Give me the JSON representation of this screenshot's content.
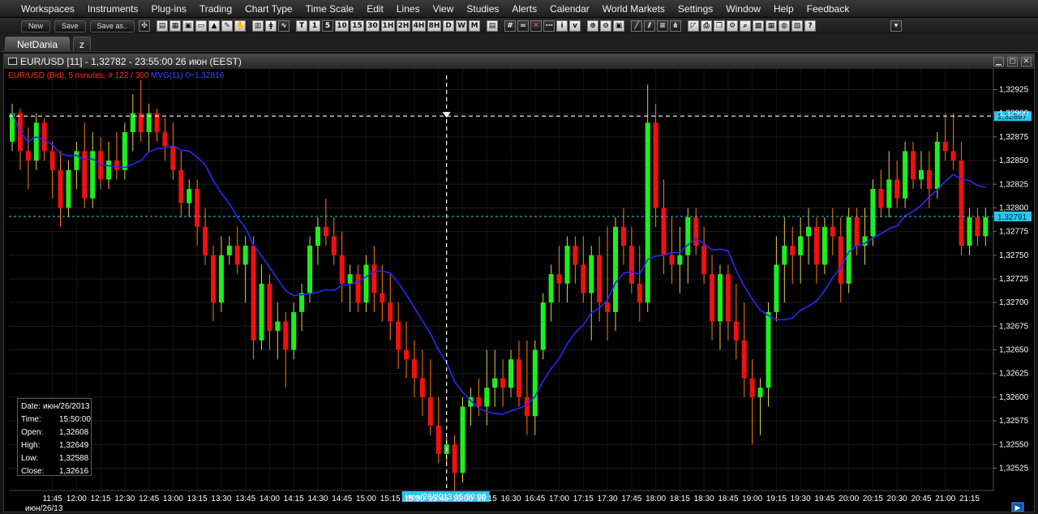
{
  "menu": [
    "Workspaces",
    "Instruments",
    "Plug-ins",
    "Trading",
    "Chart Type",
    "Time Scale",
    "Edit",
    "Lines",
    "View",
    "Studies",
    "Alerts",
    "Calendar",
    "World Markets",
    "Settings",
    "Window",
    "Help",
    "Feedback"
  ],
  "toolbar": {
    "new_label": "New",
    "save_label": "Save",
    "save_as_label": "Save as..",
    "timeframes": [
      "T",
      "1",
      "5",
      "10",
      "15",
      "30",
      "1H",
      "2H",
      "4H",
      "8H",
      "D",
      "W",
      "M"
    ]
  },
  "tabs": [
    "NetDania",
    "z"
  ],
  "window": {
    "title": "EUR/USD [11] - 1,32782 - 23:55:00  26 июн (EEST)"
  },
  "legend": {
    "instrument": "EUR/USD (Bid), 5 minutes, # 122 / 300",
    "indicator": "MVG(11) 0=1,32816"
  },
  "info_box": {
    "rows": [
      {
        "label": "Date:",
        "value": "июн/26/2013"
      },
      {
        "label": "Time:",
        "value": "15:50:00"
      },
      {
        "label": "Open:",
        "value": "1,32608"
      },
      {
        "label": "High:",
        "value": "1,32649"
      },
      {
        "label": "Low:",
        "value": "1,32588"
      },
      {
        "label": "Close:",
        "value": "1,32616"
      }
    ]
  },
  "colors": {
    "up": "#1cf01c",
    "down": "#f01010",
    "wick_up": "#e8d040",
    "wick_down": "#ff7a10",
    "ma": "#2828ff",
    "crosshair": "#ffffff",
    "last_line": "#3ac8d8",
    "price_label_bg": "#28c8f0"
  },
  "chart_data": {
    "type": "candlestick",
    "instrument": "EUR/USD (Bid)",
    "timeframe": "5 minutes",
    "y_ticks": [
      "1,32925",
      "1,32900",
      "1,32875",
      "1,32850",
      "1,32825",
      "1,32800",
      "1,32775",
      "1,32750",
      "1,32725",
      "1,32700",
      "1,32675",
      "1,32650",
      "1,32625",
      "1,32600",
      "1,32575",
      "1,32550",
      "1,32525"
    ],
    "ylim": [
      1.3251,
      1.3294
    ],
    "x_ticks": [
      "11:45",
      "12:00",
      "12:15",
      "12:30",
      "12:45",
      "13:00",
      "13:15",
      "13:30",
      "13:45",
      "14:00",
      "14:15",
      "14:30",
      "14:45",
      "15:00",
      "15:15",
      "15:30",
      "15:45",
      "16:00",
      "16:15",
      "16:30",
      "16:45",
      "17:00",
      "17:15",
      "17:30",
      "17:45",
      "18:00",
      "18:15",
      "18:30",
      "18:45",
      "19:00",
      "19:15",
      "19:30",
      "19:45",
      "20:00",
      "20:15",
      "20:30",
      "20:45",
      "21:00",
      "21:15"
    ],
    "x_date_label": "июн/26/13",
    "crosshair_time_label": "июн/26/2013 15:50:00",
    "crosshair_price_label": "1,32897",
    "last_price_label": "1,32791",
    "candles": [
      {
        "t": "11:20",
        "o": 1.3287,
        "h": 1.3291,
        "l": 1.3286,
        "c": 1.329
      },
      {
        "t": "11:25",
        "o": 1.329,
        "h": 1.32905,
        "l": 1.3284,
        "c": 1.3286
      },
      {
        "t": "11:30",
        "o": 1.3286,
        "h": 1.32885,
        "l": 1.3282,
        "c": 1.3285
      },
      {
        "t": "11:35",
        "o": 1.3285,
        "h": 1.329,
        "l": 1.3284,
        "c": 1.3289
      },
      {
        "t": "11:40",
        "o": 1.3289,
        "h": 1.32895,
        "l": 1.3285,
        "c": 1.3286
      },
      {
        "t": "11:45",
        "o": 1.3286,
        "h": 1.3287,
        "l": 1.3281,
        "c": 1.3284
      },
      {
        "t": "11:50",
        "o": 1.3284,
        "h": 1.3286,
        "l": 1.3278,
        "c": 1.328
      },
      {
        "t": "11:55",
        "o": 1.328,
        "h": 1.3285,
        "l": 1.3279,
        "c": 1.3284
      },
      {
        "t": "12:00",
        "o": 1.3284,
        "h": 1.3287,
        "l": 1.3282,
        "c": 1.3286
      },
      {
        "t": "12:05",
        "o": 1.3286,
        "h": 1.3289,
        "l": 1.328,
        "c": 1.3281
      },
      {
        "t": "12:10",
        "o": 1.3281,
        "h": 1.3288,
        "l": 1.328,
        "c": 1.3286
      },
      {
        "t": "12:15",
        "o": 1.3286,
        "h": 1.32875,
        "l": 1.3282,
        "c": 1.3283
      },
      {
        "t": "12:20",
        "o": 1.3283,
        "h": 1.3287,
        "l": 1.3282,
        "c": 1.3285
      },
      {
        "t": "12:25",
        "o": 1.3285,
        "h": 1.3288,
        "l": 1.3283,
        "c": 1.3284
      },
      {
        "t": "12:30",
        "o": 1.3284,
        "h": 1.3289,
        "l": 1.3283,
        "c": 1.3288
      },
      {
        "t": "12:35",
        "o": 1.3288,
        "h": 1.3292,
        "l": 1.3286,
        "c": 1.329
      },
      {
        "t": "12:40",
        "o": 1.329,
        "h": 1.32935,
        "l": 1.3287,
        "c": 1.3288
      },
      {
        "t": "12:45",
        "o": 1.3288,
        "h": 1.3291,
        "l": 1.3286,
        "c": 1.329
      },
      {
        "t": "12:50",
        "o": 1.329,
        "h": 1.32905,
        "l": 1.3287,
        "c": 1.3288
      },
      {
        "t": "12:55",
        "o": 1.3288,
        "h": 1.32895,
        "l": 1.3285,
        "c": 1.32865
      },
      {
        "t": "13:00",
        "o": 1.32865,
        "h": 1.3289,
        "l": 1.3283,
        "c": 1.3284
      },
      {
        "t": "13:05",
        "o": 1.3284,
        "h": 1.3286,
        "l": 1.3279,
        "c": 1.32805
      },
      {
        "t": "13:10",
        "o": 1.32805,
        "h": 1.3283,
        "l": 1.3279,
        "c": 1.3282
      },
      {
        "t": "13:15",
        "o": 1.3282,
        "h": 1.3283,
        "l": 1.3276,
        "c": 1.3278
      },
      {
        "t": "13:20",
        "o": 1.3278,
        "h": 1.328,
        "l": 1.3274,
        "c": 1.3275
      },
      {
        "t": "13:25",
        "o": 1.3275,
        "h": 1.3276,
        "l": 1.3268,
        "c": 1.327
      },
      {
        "t": "13:30",
        "o": 1.327,
        "h": 1.3277,
        "l": 1.3269,
        "c": 1.3275
      },
      {
        "t": "13:35",
        "o": 1.3275,
        "h": 1.3277,
        "l": 1.3274,
        "c": 1.3276
      },
      {
        "t": "13:40",
        "o": 1.3276,
        "h": 1.3278,
        "l": 1.3273,
        "c": 1.3274
      },
      {
        "t": "13:45",
        "o": 1.3274,
        "h": 1.3277,
        "l": 1.327,
        "c": 1.3276
      },
      {
        "t": "13:50",
        "o": 1.3276,
        "h": 1.3277,
        "l": 1.3264,
        "c": 1.3266
      },
      {
        "t": "13:55",
        "o": 1.3266,
        "h": 1.3274,
        "l": 1.3265,
        "c": 1.3272
      },
      {
        "t": "14:00",
        "o": 1.3272,
        "h": 1.3273,
        "l": 1.3265,
        "c": 1.3267
      },
      {
        "t": "14:05",
        "o": 1.3267,
        "h": 1.327,
        "l": 1.3264,
        "c": 1.3268
      },
      {
        "t": "14:10",
        "o": 1.3268,
        "h": 1.3269,
        "l": 1.3261,
        "c": 1.3265
      },
      {
        "t": "14:15",
        "o": 1.3265,
        "h": 1.327,
        "l": 1.3264,
        "c": 1.3269
      },
      {
        "t": "14:20",
        "o": 1.3269,
        "h": 1.3272,
        "l": 1.3267,
        "c": 1.3271
      },
      {
        "t": "14:25",
        "o": 1.3271,
        "h": 1.3277,
        "l": 1.327,
        "c": 1.3276
      },
      {
        "t": "14:30",
        "o": 1.3276,
        "h": 1.3279,
        "l": 1.3274,
        "c": 1.3278
      },
      {
        "t": "14:35",
        "o": 1.3278,
        "h": 1.3281,
        "l": 1.3276,
        "c": 1.3277
      },
      {
        "t": "14:40",
        "o": 1.3277,
        "h": 1.3279,
        "l": 1.3274,
        "c": 1.3275
      },
      {
        "t": "14:45",
        "o": 1.3275,
        "h": 1.32775,
        "l": 1.327,
        "c": 1.3272
      },
      {
        "t": "14:50",
        "o": 1.3272,
        "h": 1.3274,
        "l": 1.3269,
        "c": 1.3273
      },
      {
        "t": "14:55",
        "o": 1.3273,
        "h": 1.3274,
        "l": 1.3269,
        "c": 1.327
      },
      {
        "t": "15:00",
        "o": 1.327,
        "h": 1.3275,
        "l": 1.3269,
        "c": 1.3274
      },
      {
        "t": "15:05",
        "o": 1.3274,
        "h": 1.3276,
        "l": 1.3269,
        "c": 1.3271
      },
      {
        "t": "15:10",
        "o": 1.3271,
        "h": 1.3274,
        "l": 1.3268,
        "c": 1.327
      },
      {
        "t": "15:15",
        "o": 1.327,
        "h": 1.3273,
        "l": 1.3266,
        "c": 1.3268
      },
      {
        "t": "15:20",
        "o": 1.3268,
        "h": 1.327,
        "l": 1.3263,
        "c": 1.3265
      },
      {
        "t": "15:25",
        "o": 1.3265,
        "h": 1.3268,
        "l": 1.3262,
        "c": 1.3264
      },
      {
        "t": "15:30",
        "o": 1.3264,
        "h": 1.3266,
        "l": 1.326,
        "c": 1.3262
      },
      {
        "t": "15:35",
        "o": 1.3262,
        "h": 1.3265,
        "l": 1.3258,
        "c": 1.326
      },
      {
        "t": "15:40",
        "o": 1.326,
        "h": 1.3264,
        "l": 1.3256,
        "c": 1.3257
      },
      {
        "t": "15:45",
        "o": 1.3257,
        "h": 1.326,
        "l": 1.3253,
        "c": 1.3254
      },
      {
        "t": "15:50",
        "o": 1.3254,
        "h": 1.3256,
        "l": 1.3253,
        "c": 1.3255
      },
      {
        "t": "15:55",
        "o": 1.3255,
        "h": 1.3256,
        "l": 1.325,
        "c": 1.3252
      },
      {
        "t": "16:00",
        "o": 1.3252,
        "h": 1.326,
        "l": 1.3251,
        "c": 1.3259
      },
      {
        "t": "16:05",
        "o": 1.3259,
        "h": 1.3261,
        "l": 1.3257,
        "c": 1.326
      },
      {
        "t": "16:10",
        "o": 1.326,
        "h": 1.3262,
        "l": 1.3258,
        "c": 1.3259
      },
      {
        "t": "16:15",
        "o": 1.3259,
        "h": 1.3265,
        "l": 1.3257,
        "c": 1.3261
      },
      {
        "t": "16:20",
        "o": 1.3261,
        "h": 1.3265,
        "l": 1.3259,
        "c": 1.3262
      },
      {
        "t": "16:25",
        "o": 1.3262,
        "h": 1.3264,
        "l": 1.3259,
        "c": 1.3261
      },
      {
        "t": "16:30",
        "o": 1.3261,
        "h": 1.3265,
        "l": 1.326,
        "c": 1.3264
      },
      {
        "t": "16:35",
        "o": 1.3264,
        "h": 1.3266,
        "l": 1.3259,
        "c": 1.326
      },
      {
        "t": "16:40",
        "o": 1.326,
        "h": 1.3266,
        "l": 1.3256,
        "c": 1.3258
      },
      {
        "t": "16:45",
        "o": 1.3258,
        "h": 1.3266,
        "l": 1.3256,
        "c": 1.3265
      },
      {
        "t": "16:50",
        "o": 1.3265,
        "h": 1.3271,
        "l": 1.3264,
        "c": 1.327
      },
      {
        "t": "16:55",
        "o": 1.327,
        "h": 1.3274,
        "l": 1.3268,
        "c": 1.3273
      },
      {
        "t": "17:00",
        "o": 1.3273,
        "h": 1.3276,
        "l": 1.327,
        "c": 1.3272
      },
      {
        "t": "17:05",
        "o": 1.3272,
        "h": 1.3277,
        "l": 1.327,
        "c": 1.3276
      },
      {
        "t": "17:10",
        "o": 1.3276,
        "h": 1.3277,
        "l": 1.3272,
        "c": 1.3274
      },
      {
        "t": "17:15",
        "o": 1.3274,
        "h": 1.3277,
        "l": 1.327,
        "c": 1.3271
      },
      {
        "t": "17:20",
        "o": 1.3271,
        "h": 1.3276,
        "l": 1.3266,
        "c": 1.3275
      },
      {
        "t": "17:25",
        "o": 1.3275,
        "h": 1.3277,
        "l": 1.3268,
        "c": 1.327
      },
      {
        "t": "17:30",
        "o": 1.327,
        "h": 1.3278,
        "l": 1.3266,
        "c": 1.3269
      },
      {
        "t": "17:35",
        "o": 1.3269,
        "h": 1.3279,
        "l": 1.3267,
        "c": 1.3278
      },
      {
        "t": "17:40",
        "o": 1.3278,
        "h": 1.328,
        "l": 1.3274,
        "c": 1.3276
      },
      {
        "t": "17:45",
        "o": 1.3276,
        "h": 1.3278,
        "l": 1.3271,
        "c": 1.3272
      },
      {
        "t": "17:50",
        "o": 1.3272,
        "h": 1.3276,
        "l": 1.3268,
        "c": 1.327
      },
      {
        "t": "17:55",
        "o": 1.327,
        "h": 1.3293,
        "l": 1.3269,
        "c": 1.3289
      },
      {
        "t": "18:00",
        "o": 1.3289,
        "h": 1.3291,
        "l": 1.3278,
        "c": 1.328
      },
      {
        "t": "18:05",
        "o": 1.328,
        "h": 1.3283,
        "l": 1.3273,
        "c": 1.3275
      },
      {
        "t": "18:10",
        "o": 1.3275,
        "h": 1.3279,
        "l": 1.3272,
        "c": 1.3274
      },
      {
        "t": "18:15",
        "o": 1.3274,
        "h": 1.3278,
        "l": 1.3271,
        "c": 1.3275
      },
      {
        "t": "18:20",
        "o": 1.3275,
        "h": 1.328,
        "l": 1.3272,
        "c": 1.3279
      },
      {
        "t": "18:25",
        "o": 1.3279,
        "h": 1.328,
        "l": 1.3275,
        "c": 1.3276
      },
      {
        "t": "18:30",
        "o": 1.3276,
        "h": 1.3278,
        "l": 1.3272,
        "c": 1.3273
      },
      {
        "t": "18:35",
        "o": 1.3273,
        "h": 1.3275,
        "l": 1.3266,
        "c": 1.3268
      },
      {
        "t": "18:40",
        "o": 1.3268,
        "h": 1.3274,
        "l": 1.3265,
        "c": 1.3273
      },
      {
        "t": "18:45",
        "o": 1.3273,
        "h": 1.3274,
        "l": 1.3266,
        "c": 1.3268
      },
      {
        "t": "18:50",
        "o": 1.3268,
        "h": 1.3272,
        "l": 1.3264,
        "c": 1.3266
      },
      {
        "t": "18:55",
        "o": 1.3266,
        "h": 1.327,
        "l": 1.326,
        "c": 1.3262
      },
      {
        "t": "19:00",
        "o": 1.3262,
        "h": 1.3264,
        "l": 1.3255,
        "c": 1.326
      },
      {
        "t": "19:05",
        "o": 1.326,
        "h": 1.3262,
        "l": 1.3256,
        "c": 1.3261
      },
      {
        "t": "19:10",
        "o": 1.3261,
        "h": 1.327,
        "l": 1.3259,
        "c": 1.3269
      },
      {
        "t": "19:15",
        "o": 1.3269,
        "h": 1.3277,
        "l": 1.3268,
        "c": 1.3274
      },
      {
        "t": "19:20",
        "o": 1.3274,
        "h": 1.3279,
        "l": 1.327,
        "c": 1.3276
      },
      {
        "t": "19:25",
        "o": 1.3276,
        "h": 1.3278,
        "l": 1.3272,
        "c": 1.3275
      },
      {
        "t": "19:30",
        "o": 1.3275,
        "h": 1.3279,
        "l": 1.3272,
        "c": 1.3277
      },
      {
        "t": "19:35",
        "o": 1.3277,
        "h": 1.328,
        "l": 1.3274,
        "c": 1.3278
      },
      {
        "t": "19:40",
        "o": 1.3278,
        "h": 1.3279,
        "l": 1.3272,
        "c": 1.3274
      },
      {
        "t": "19:45",
        "o": 1.3274,
        "h": 1.3279,
        "l": 1.3273,
        "c": 1.3278
      },
      {
        "t": "19:50",
        "o": 1.3278,
        "h": 1.328,
        "l": 1.3275,
        "c": 1.3277
      },
      {
        "t": "19:55",
        "o": 1.3277,
        "h": 1.3279,
        "l": 1.327,
        "c": 1.3272
      },
      {
        "t": "20:00",
        "o": 1.3272,
        "h": 1.328,
        "l": 1.3271,
        "c": 1.3279
      },
      {
        "t": "20:05",
        "o": 1.3279,
        "h": 1.328,
        "l": 1.3275,
        "c": 1.3276
      },
      {
        "t": "20:10",
        "o": 1.3276,
        "h": 1.328,
        "l": 1.3274,
        "c": 1.3277
      },
      {
        "t": "20:15",
        "o": 1.3277,
        "h": 1.3283,
        "l": 1.3276,
        "c": 1.3282
      },
      {
        "t": "20:20",
        "o": 1.3282,
        "h": 1.3284,
        "l": 1.3279,
        "c": 1.328
      },
      {
        "t": "20:25",
        "o": 1.328,
        "h": 1.3286,
        "l": 1.3279,
        "c": 1.3283
      },
      {
        "t": "20:30",
        "o": 1.3283,
        "h": 1.3285,
        "l": 1.328,
        "c": 1.3281
      },
      {
        "t": "20:35",
        "o": 1.3281,
        "h": 1.3287,
        "l": 1.328,
        "c": 1.3286
      },
      {
        "t": "20:40",
        "o": 1.3286,
        "h": 1.3287,
        "l": 1.3282,
        "c": 1.3283
      },
      {
        "t": "20:45",
        "o": 1.3283,
        "h": 1.3286,
        "l": 1.3282,
        "c": 1.3284
      },
      {
        "t": "20:50",
        "o": 1.3284,
        "h": 1.3286,
        "l": 1.328,
        "c": 1.3282
      },
      {
        "t": "20:55",
        "o": 1.3282,
        "h": 1.3288,
        "l": 1.3281,
        "c": 1.3287
      },
      {
        "t": "21:00",
        "o": 1.3287,
        "h": 1.329,
        "l": 1.3285,
        "c": 1.3286
      },
      {
        "t": "21:05",
        "o": 1.3286,
        "h": 1.329,
        "l": 1.3284,
        "c": 1.3285
      },
      {
        "t": "21:10",
        "o": 1.3285,
        "h": 1.3287,
        "l": 1.3275,
        "c": 1.3276
      },
      {
        "t": "21:15",
        "o": 1.3276,
        "h": 1.328,
        "l": 1.3275,
        "c": 1.3279
      },
      {
        "t": "21:20",
        "o": 1.3279,
        "h": 1.328,
        "l": 1.3276,
        "c": 1.3277
      },
      {
        "t": "21:25",
        "o": 1.3277,
        "h": 1.328,
        "l": 1.3276,
        "c": 1.3279
      }
    ]
  }
}
